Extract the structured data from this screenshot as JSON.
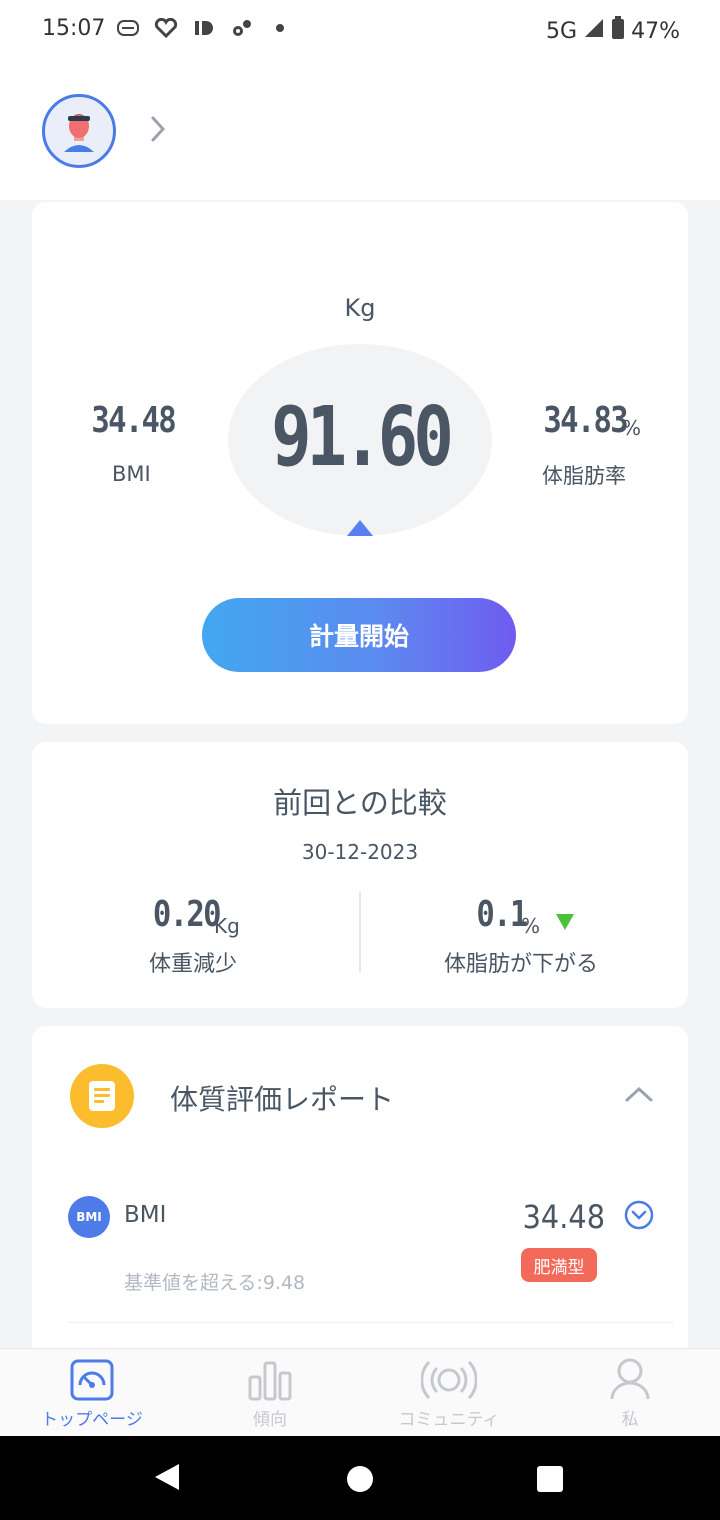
{
  "status_bar": {
    "time": "15:07",
    "network": "5G",
    "battery": "47%",
    "icons": [
      "app-icon",
      "heart-icon",
      "id-icon",
      "gears-icon",
      "dot-icon"
    ]
  },
  "header": {
    "avatar_icon": "user-avatar",
    "chevron_icon": "chevron-right-icon"
  },
  "measurement": {
    "unit": "Kg",
    "weight": "91.60",
    "bmi_value": "34.48",
    "bmi_label": "BMI",
    "fat_value": "34.83",
    "fat_unit": "%",
    "fat_label": "体脂肪率",
    "start_button": "計量開始"
  },
  "comparison": {
    "title": "前回との比較",
    "date": "30-12-2023",
    "weight_change": "0.20",
    "weight_unit": "Kg",
    "weight_label": "体重減少",
    "fat_change": "0.1",
    "fat_unit": "%",
    "fat_label": "体脂肪が下がる",
    "fat_trend_color": "#4cc13a"
  },
  "report": {
    "title": "体質評価レポート",
    "icon": "document-icon",
    "item_badge": "BMI",
    "item_name": "BMI",
    "item_value": "34.48",
    "item_tag": "肥満型",
    "item_note": "基準値を超える:9.48",
    "tag_color": "#f46a5a"
  },
  "bottom_nav": {
    "items": [
      {
        "label": "トップページ",
        "icon": "gauge-icon",
        "active": true
      },
      {
        "label": "傾向",
        "icon": "bar-chart-icon",
        "active": false
      },
      {
        "label": "コミュニティ",
        "icon": "broadcast-icon",
        "active": false
      },
      {
        "label": "私",
        "icon": "person-icon",
        "active": false
      }
    ]
  },
  "accent_color": "#4d7be8"
}
